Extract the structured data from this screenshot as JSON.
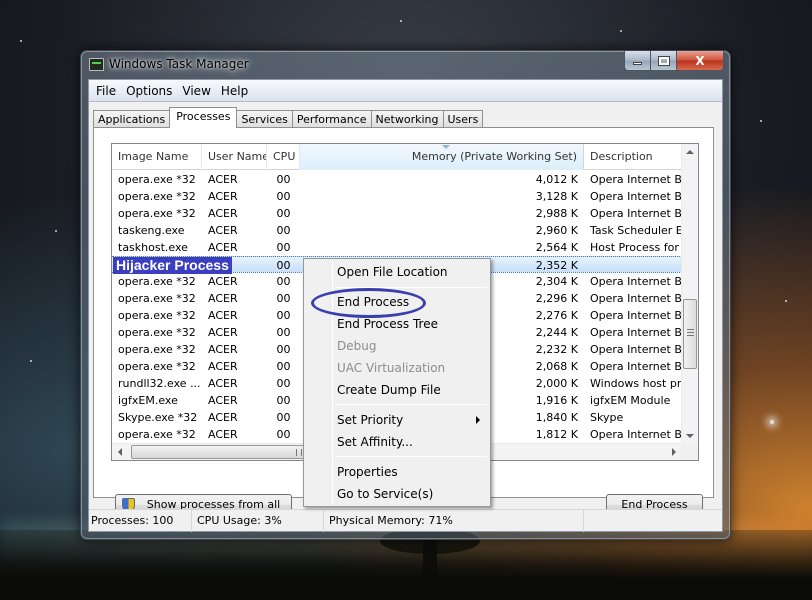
{
  "window": {
    "title": "Windows Task Manager",
    "caption_buttons": {
      "minimize": "minimize",
      "maximize": "maximize",
      "close": "X"
    }
  },
  "menubar": [
    "File",
    "Options",
    "View",
    "Help"
  ],
  "tabs": [
    {
      "label": "Applications",
      "active": false
    },
    {
      "label": "Processes",
      "active": true
    },
    {
      "label": "Services",
      "active": false
    },
    {
      "label": "Performance",
      "active": false
    },
    {
      "label": "Networking",
      "active": false
    },
    {
      "label": "Users",
      "active": false
    }
  ],
  "process_table": {
    "columns": [
      "Image Name",
      "User Name",
      "CPU",
      "Memory (Private Working Set)",
      "Description"
    ],
    "sorted_column": "Memory (Private Working Set)",
    "rows": [
      {
        "name": "opera.exe *32",
        "user": "ACER",
        "cpu": "00",
        "memory": "4,012 K",
        "description": "Opera Internet Brow"
      },
      {
        "name": "opera.exe *32",
        "user": "ACER",
        "cpu": "00",
        "memory": "3,128 K",
        "description": "Opera Internet Brow"
      },
      {
        "name": "opera.exe *32",
        "user": "ACER",
        "cpu": "00",
        "memory": "2,988 K",
        "description": "Opera Internet Brow"
      },
      {
        "name": "taskeng.exe",
        "user": "ACER",
        "cpu": "00",
        "memory": "2,960 K",
        "description": "Task Scheduler Engi"
      },
      {
        "name": "taskhost.exe",
        "user": "ACER",
        "cpu": "00",
        "memory": "2,564 K",
        "description": "Host Process for Wi"
      },
      {
        "name": "Hijacker Process",
        "user": "",
        "cpu": "00",
        "memory": "2,352 K",
        "description": "",
        "selected": true
      },
      {
        "name": "opera.exe *32",
        "user": "ACER",
        "cpu": "00",
        "memory": "2,304 K",
        "description": "Opera Internet Brow"
      },
      {
        "name": "opera.exe *32",
        "user": "ACER",
        "cpu": "00",
        "memory": "2,296 K",
        "description": "Opera Internet Brow"
      },
      {
        "name": "opera.exe *32",
        "user": "ACER",
        "cpu": "00",
        "memory": "2,276 K",
        "description": "Opera Internet Brow"
      },
      {
        "name": "opera.exe *32",
        "user": "ACER",
        "cpu": "00",
        "memory": "2,244 K",
        "description": "Opera Internet Brow"
      },
      {
        "name": "opera.exe *32",
        "user": "ACER",
        "cpu": "00",
        "memory": "2,232 K",
        "description": "Opera Internet Brow"
      },
      {
        "name": "opera.exe *32",
        "user": "ACER",
        "cpu": "00",
        "memory": "2,068 K",
        "description": "Opera Internet Brow"
      },
      {
        "name": "rundll32.exe ...",
        "user": "ACER",
        "cpu": "00",
        "memory": "2,000 K",
        "description": "Windows host proce"
      },
      {
        "name": "igfxEM.exe",
        "user": "ACER",
        "cpu": "00",
        "memory": "1,916 K",
        "description": "igfxEM Module"
      },
      {
        "name": "Skype.exe *32",
        "user": "ACER",
        "cpu": "00",
        "memory": "1,840 K",
        "description": "Skype"
      },
      {
        "name": "opera.exe *32",
        "user": "ACER",
        "cpu": "00",
        "memory": "1,812 K",
        "description": "Opera Internet Brow"
      }
    ]
  },
  "buttons": {
    "show_all_prefix": "S",
    "show_all_rest": "how processes from all users",
    "end_process_prefix": "E",
    "end_process_rest": "nd Process"
  },
  "context_menu": {
    "items": [
      {
        "label": "Open File Location",
        "disabled": false
      },
      {
        "label": "End Process",
        "disabled": false,
        "highlighted": true
      },
      {
        "label": "End Process Tree",
        "disabled": false
      },
      {
        "label": "Debug",
        "disabled": true
      },
      {
        "label": "UAC Virtualization",
        "disabled": true
      },
      {
        "label": "Create Dump File",
        "disabled": false
      },
      {
        "label": "Set Priority",
        "disabled": false,
        "submenu": true
      },
      {
        "label": "Set Affinity...",
        "disabled": false
      },
      {
        "label": "Properties",
        "disabled": false
      },
      {
        "label": "Go to Service(s)",
        "disabled": false
      }
    ]
  },
  "statusbar": {
    "processes": "Processes: 100",
    "cpu_usage": "CPU Usage: 3%",
    "physical_memory": "Physical Memory: 71%"
  },
  "colors": {
    "hijacker_highlight": "#3b3fbf",
    "annotation_ellipse": "#3a3fae",
    "close_button": "#c8452d"
  }
}
